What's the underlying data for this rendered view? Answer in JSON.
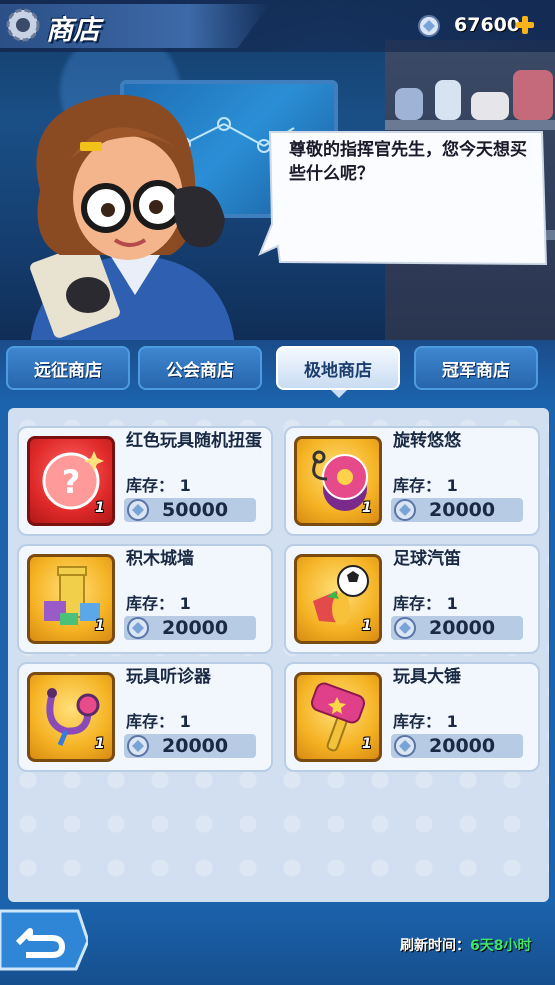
{
  "header": {
    "title": "商店",
    "currency": {
      "icon": "coin-icon",
      "amount": "67600"
    }
  },
  "npc": {
    "speech": "尊敬的指挥官先生，您今天想买些什么呢？"
  },
  "tabs": [
    {
      "label": "远征商店",
      "active": false
    },
    {
      "label": "公会商店",
      "active": false
    },
    {
      "label": "极地商店",
      "active": true
    },
    {
      "label": "冠军商店",
      "active": false
    }
  ],
  "items": [
    {
      "name": "红色玩具随机扭蛋",
      "stock_label": "库存：",
      "stock": "1",
      "price": "50000",
      "qty": "1",
      "icon": "red-capsule-icon"
    },
    {
      "name": "旋转悠悠",
      "stock_label": "库存：",
      "stock": "1",
      "price": "20000",
      "qty": "1",
      "icon": "yoyo-icon"
    },
    {
      "name": "积木城墙",
      "stock_label": "库存：",
      "stock": "1",
      "price": "20000",
      "qty": "1",
      "icon": "block-castle-icon"
    },
    {
      "name": "足球汽笛",
      "stock_label": "库存：",
      "stock": "1",
      "price": "20000",
      "qty": "1",
      "icon": "soccer-horn-icon"
    },
    {
      "name": "玩具听诊器",
      "stock_label": "库存：",
      "stock": "1",
      "price": "20000",
      "qty": "1",
      "icon": "stethoscope-icon"
    },
    {
      "name": "玩具大锤",
      "stock_label": "库存：",
      "stock": "1",
      "price": "20000",
      "qty": "1",
      "icon": "toy-hammer-icon"
    }
  ],
  "footer": {
    "refresh_label": "刷新时间：",
    "refresh_value": "6天8小时"
  },
  "colors": {
    "accent": "#1b63ad",
    "gold": "#f5b324",
    "refresh": "#3fe46a"
  }
}
